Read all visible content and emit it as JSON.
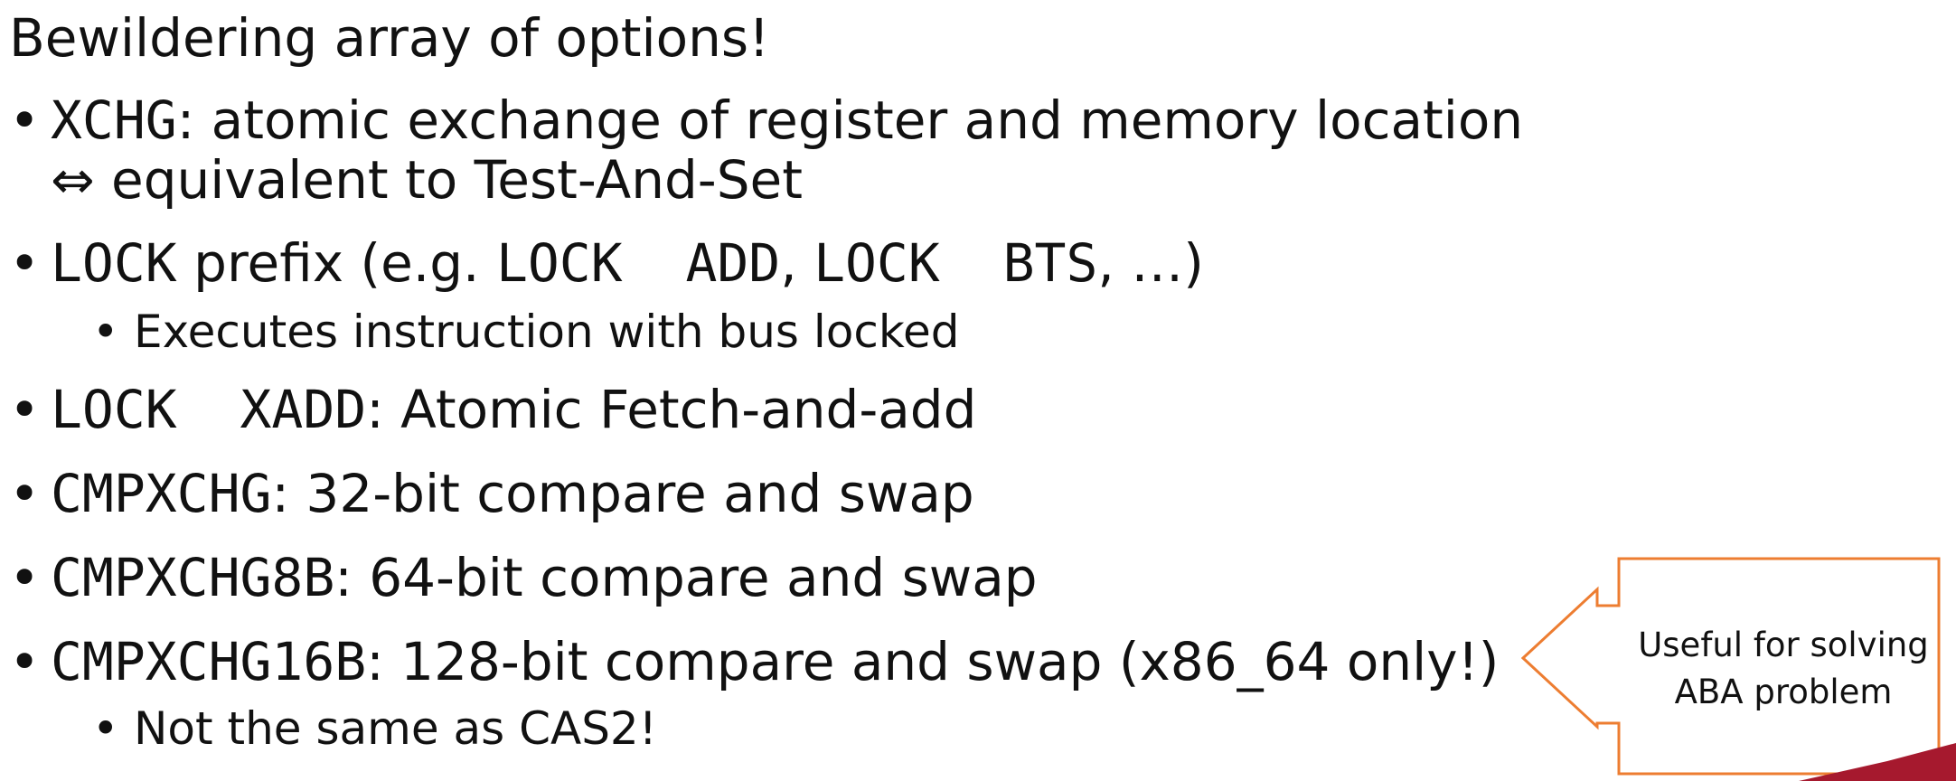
{
  "heading": "Bewildering array of options!",
  "bullets": {
    "xchg_code": "XCHG",
    "xchg_text": ": atomic exchange of register and memory location",
    "xchg_cont_symbol": "⇔",
    "xchg_cont_text": " equivalent to Test-And-Set",
    "lock_prefix_code": "LOCK",
    "lock_prefix_text1": " prefix (e.g. ",
    "lock_add_code": "LOCK  ADD",
    "lock_prefix_comma": ", ",
    "lock_bts_code": "LOCK  BTS",
    "lock_prefix_text2": ", …)",
    "lock_sub": "Executes instruction with bus locked",
    "xadd_code": "LOCK  XADD",
    "xadd_text": ": Atomic Fetch-and-add",
    "cmpxchg_code": "CMPXCHG",
    "cmpxchg_text": ": 32-bit compare and swap",
    "cmpxchg8b_code": "CMPXCHG8B",
    "cmpxchg8b_text": ": 64-bit compare and swap",
    "cmpxchg16b_code": "CMPXCHG16B",
    "cmpxchg16b_text": ": 128-bit compare and swap (x86_64 only!)",
    "cmpxchg16b_sub": "Not the same as CAS2!"
  },
  "callout": {
    "line1": "Useful for solving",
    "line2": "ABA problem",
    "border_color": "#ed7d31"
  },
  "accent_color": "#a6192e",
  "bullet_glyph": "•"
}
